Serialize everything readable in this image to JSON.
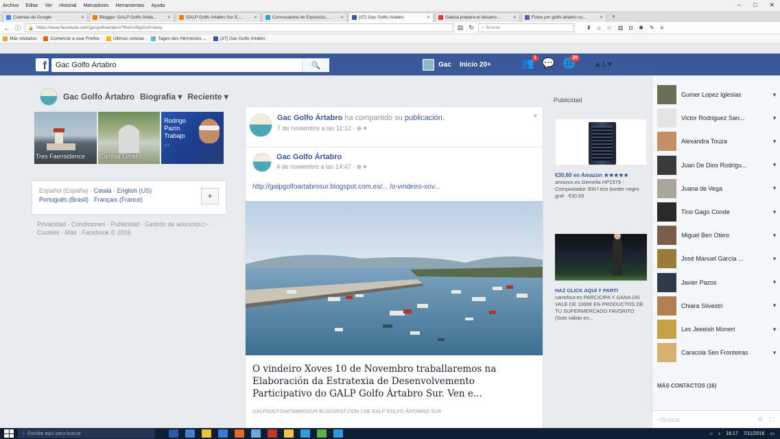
{
  "browser": {
    "menu": [
      "Archivo",
      "Editar",
      "Ver",
      "Historial",
      "Marcadores",
      "Herramientas",
      "Ayuda"
    ],
    "window_controls": [
      "–",
      "□",
      "✕"
    ],
    "tabs": [
      {
        "label": "Cuentas de Google",
        "color": "#4285f4",
        "active": false
      },
      {
        "label": "Blogger: GALP Golfo Ártab...",
        "color": "#f57d00",
        "active": false
      },
      {
        "label": "GALP Golfo Ártabro Sur E...",
        "color": "#f57d00",
        "active": false
      },
      {
        "label": "Convocatoria de Exposicio...",
        "color": "#29a3d6",
        "active": false
      },
      {
        "label": "(37) Gac Golfo Ártabro",
        "color": "#3b5998",
        "active": true
      },
      {
        "label": "Galicia prepara el desarro...",
        "color": "#d83b3b",
        "active": false
      },
      {
        "label": "Fotos por golfo ártabro su...",
        "color": "#5566aa",
        "active": false
      }
    ],
    "new_tab": "+",
    "url": "https://www.facebook.com/gacgolfoartabro/?fref=nf&pnref=story",
    "search_placeholder": "Buscar",
    "bookmarks": [
      {
        "label": "Más visitados",
        "color": "#e5a33b"
      },
      {
        "label": "Comenzar a usar Firefox",
        "color": "#e66000"
      },
      {
        "label": "Últimas noticias",
        "color": "#ffb300"
      },
      {
        "label": "Tagen des Hérmes/es ...",
        "color": "#6bb2d6"
      },
      {
        "label": "(37) Gac Golfo Ártabro",
        "color": "#3b5998"
      }
    ]
  },
  "fb": {
    "logo": "f",
    "search_value": "Gac Golfo Ártabro",
    "search_icon": "search-icon",
    "me_label": "Gac",
    "home_label": "Inicio 20+",
    "friend_badge": "1",
    "notif_badge": "20",
    "more_label": "▲1 ▾"
  },
  "page": {
    "name": "Gac Golfo Ártabro",
    "nav": [
      "Biografía ▾",
      "Reciente ▾"
    ],
    "photos": [
      {
        "caption": "Tres Faensidence"
      },
      {
        "caption": "Cambia Lentil"
      },
      {
        "caption": "",
        "overlay": "Rodrigo Pazín Trabajo ..."
      }
    ],
    "languages_line1": [
      "Español (España)",
      "Català",
      "English (US)"
    ],
    "languages_line2": [
      "Português (Brasil)",
      "Français (France)"
    ],
    "lang_plus": "+",
    "footer": "Privacidad · Condiciones · Publicidad · Gestión de anuncios ▷ · Cookies · Más · Facebook © 2016"
  },
  "post": {
    "author": "Gac Golfo Ártabro",
    "shared_text": "ha compartido su",
    "shared_link": "publicación.",
    "time": "7 de noviembre a las 11:12 · ⊕ ▾",
    "chevron": "▾",
    "inner_author": "Gac Golfo Ártabro",
    "inner_time": "4 de noviembre a las 14:47 · ⊕ ▾",
    "inner_url": "http://galpgolfoartabrosur.blogspot.com.es/... /o-vindeiro-xov...",
    "preview_title": "O vindeiro Xoves 10 de Novembro traballaremos na Elaboración da Estratexia de Desenvolvemento Participativo do GALP Golfo Ártabro Sur. Ven e...",
    "preview_domain": "GALPGOLFOARTABROSUR.BLOGSPOT.COM | DE GALP GOLFO ÁRTABRO SUR"
  },
  "ads": {
    "title": "Publicidad",
    "ad1_headline": "€30,60 en Amazon ★★★★★",
    "ad1_body": "amazon.es Gemelia HP1579 · Compostador 300 l eco border negro graf · €30.65",
    "ad2_headline": "HAZ CLICK AQUÍ Y PARTI",
    "ad2_body": "carrefour.es PARCICIPA Y GANA UN VALE DE 1000€ EN PRODUCTOS DE TU SUPERMERCADO FAVORITO (Solo válido en..."
  },
  "chat": {
    "contacts": [
      {
        "name": "Gumer Lopez Iglesias",
        "color": "#6a6f5a"
      },
      {
        "name": "Victor Rodriguez San...",
        "color": "#e4e4e4"
      },
      {
        "name": "Alexandra Touza",
        "color": "#c49066"
      },
      {
        "name": "Juan De Dios Rodrigu...",
        "color": "#3a3a3a"
      },
      {
        "name": "Juana de Vega",
        "color": "#a7a69a"
      },
      {
        "name": "Tino Gago Conde",
        "color": "#2a2a2a"
      },
      {
        "name": "Miguel Ben Otero",
        "color": "#7a5d4c"
      },
      {
        "name": "José Manuel García ...",
        "color": "#9a7b3b"
      },
      {
        "name": "Javier Pazos",
        "color": "#2e3a4a"
      },
      {
        "name": "Chiara Silvestri",
        "color": "#b08050"
      },
      {
        "name": "Les Jeeeish Monert",
        "color": "#c6a04a"
      },
      {
        "name": "Caracola Sen Fronteiras",
        "color": "#d5b070"
      }
    ],
    "more_contacts": "MÁS CONTACTOS (16)",
    "more_icon": "▾",
    "search_placeholder": "Buscar"
  },
  "taskbar": {
    "search_placeholder": "Escribe aquí para buscar",
    "apps": [
      "#2b5aa8",
      "#4a7ec9",
      "#f0c23b",
      "#3b7bd6",
      "#e36a2c",
      "#6fa8dc",
      "#c0392b",
      "#f3c24a",
      "#2d9fd9",
      "#5bb04a",
      "#3399dd"
    ],
    "clock": "16:17",
    "date": "7/11/2016"
  }
}
